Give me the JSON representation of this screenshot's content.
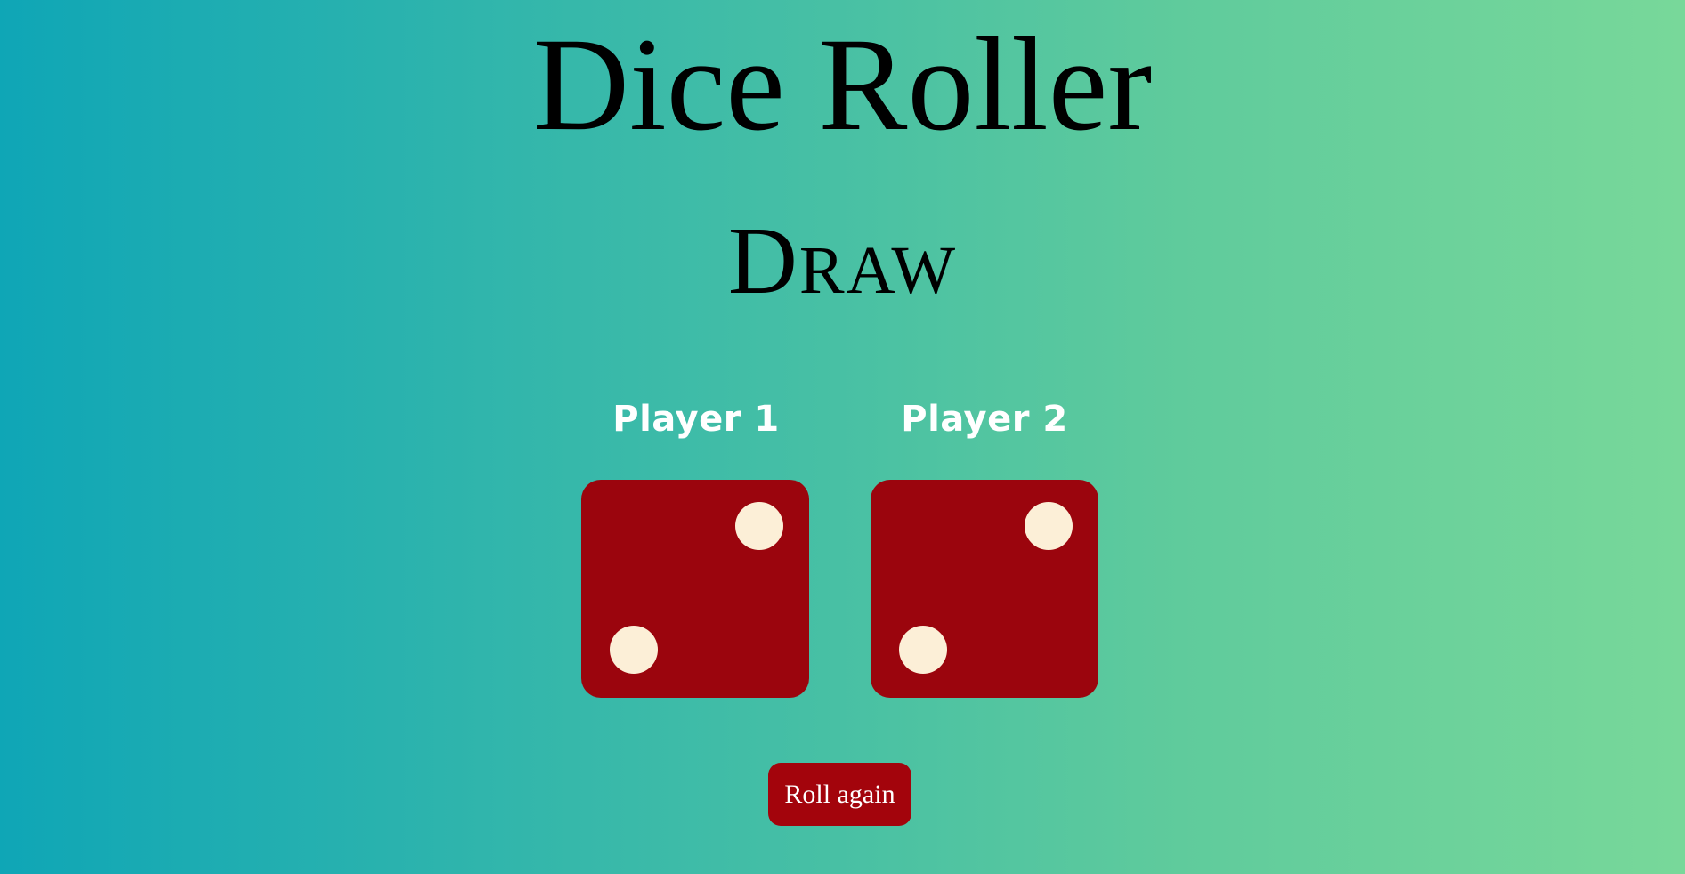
{
  "app": {
    "title": "Dice Roller",
    "result": "Draw"
  },
  "players": [
    {
      "label": "Player 1",
      "die_value": 2
    },
    {
      "label": "Player 2",
      "die_value": 2
    }
  ],
  "actions": {
    "roll_label": "Roll again"
  },
  "colors": {
    "background_start": "#0fa6b6",
    "background_end": "#78d89a",
    "die_face": "#9b050d",
    "die_pip": "#fcefd7",
    "button": "#a3040c"
  },
  "icons": {
    "die": "die-face-two"
  }
}
